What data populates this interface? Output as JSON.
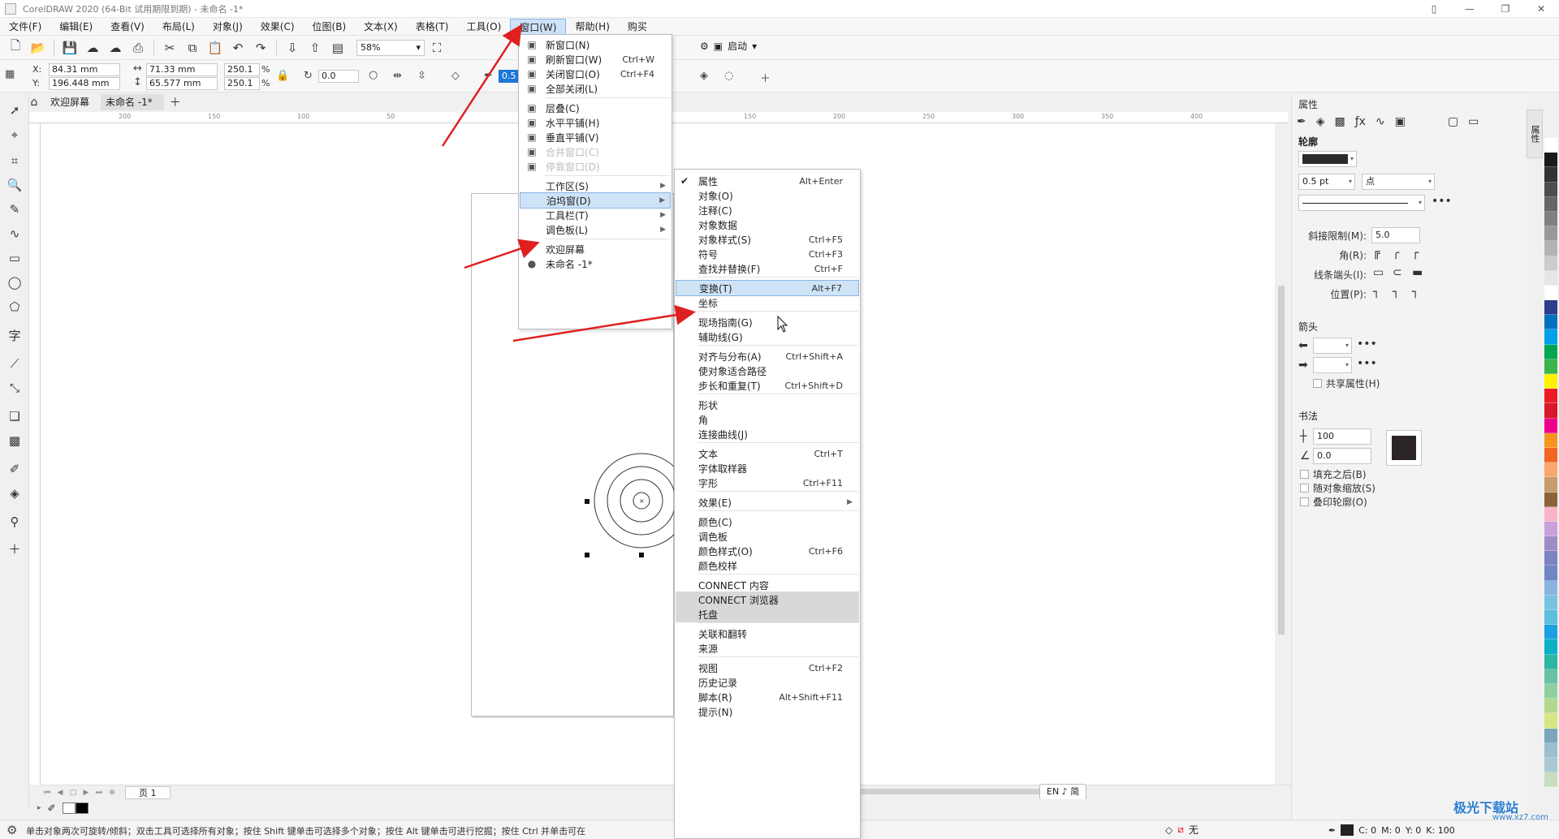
{
  "window": {
    "title": "CorelDRAW 2020 (64-Bit 试用期限到期) - 未命名 -1*"
  },
  "menubar": {
    "items": [
      "文件(F)",
      "编辑(E)",
      "查看(V)",
      "布局(L)",
      "对象(J)",
      "效果(C)",
      "位图(B)",
      "文本(X)",
      "表格(T)",
      "工具(O)",
      "窗口(W)",
      "帮助(H)",
      "购买"
    ],
    "active_index": 10
  },
  "toolbar": {
    "zoom": "58%",
    "launch_label": "启动"
  },
  "propbar": {
    "x_label": "X:",
    "x_value": "84.31 mm",
    "y_label": "Y:",
    "y_value": "196.448 mm",
    "w_value": "71.33 mm",
    "h_value": "65.577 mm",
    "scale_x": "250.1",
    "scale_y": "250.1",
    "percent": "%",
    "rotation": "0.0",
    "outline_width": "0.5 pt"
  },
  "doctabs": {
    "tabs": [
      "欢迎屏幕",
      "未命名 -1*"
    ],
    "active_index": 1
  },
  "ruler": {
    "ticks": [
      "200",
      "150",
      "100",
      "50",
      "",
      "",
      "",
      "150",
      "200",
      "250",
      "300",
      "350",
      "400"
    ]
  },
  "window_menu": {
    "items": [
      {
        "label": "新窗口(N)",
        "shortcut": "",
        "icon": "new-window-icon"
      },
      {
        "label": "刷新窗口(W)",
        "shortcut": "Ctrl+W",
        "icon": "refresh-window-icon"
      },
      {
        "label": "关闭窗口(O)",
        "shortcut": "Ctrl+F4",
        "icon": "close-window-icon"
      },
      {
        "label": "全部关闭(L)",
        "shortcut": "",
        "icon": "close-all-icon"
      },
      {
        "label": "层叠(C)",
        "shortcut": "",
        "icon": "cascade-icon"
      },
      {
        "label": "水平平铺(H)",
        "shortcut": "",
        "icon": "tile-horizontal-icon"
      },
      {
        "label": "垂直平铺(V)",
        "shortcut": "",
        "icon": "tile-vertical-icon"
      },
      {
        "label": "合并窗口(C)",
        "shortcut": "",
        "icon": "merge-window-icon",
        "disabled": true
      },
      {
        "label": "停靠窗口(D)",
        "shortcut": "",
        "icon": "dock-window-icon",
        "disabled": true
      },
      {
        "label": "工作区(S)",
        "shortcut": "",
        "submenu": true
      },
      {
        "label": "泊坞窗(D)",
        "shortcut": "",
        "submenu": true,
        "highlight": true
      },
      {
        "label": "工具栏(T)",
        "shortcut": "",
        "submenu": true
      },
      {
        "label": "调色板(L)",
        "shortcut": "",
        "submenu": true
      },
      {
        "label": "欢迎屏幕",
        "shortcut": ""
      },
      {
        "label": "未命名 -1*",
        "shortcut": "",
        "bullet": true
      }
    ]
  },
  "docker_menu": {
    "items": [
      {
        "label": "属性",
        "shortcut": "Alt+Enter",
        "checked": true
      },
      {
        "label": "对象(O)",
        "shortcut": ""
      },
      {
        "label": "注释(C)",
        "shortcut": ""
      },
      {
        "label": "对象数据",
        "shortcut": ""
      },
      {
        "label": "对象样式(S)",
        "shortcut": "Ctrl+F5"
      },
      {
        "label": "符号",
        "shortcut": "Ctrl+F3"
      },
      {
        "label": "查找并替换(F)",
        "shortcut": "Ctrl+F"
      },
      {
        "label": "变换(T)",
        "shortcut": "Alt+F7",
        "highlight": true
      },
      {
        "label": "坐标",
        "shortcut": ""
      },
      {
        "label": "现场指南(G)",
        "shortcut": ""
      },
      {
        "label": "辅助线(G)",
        "shortcut": ""
      },
      {
        "label": "对齐与分布(A)",
        "shortcut": "Ctrl+Shift+A"
      },
      {
        "label": "使对象适合路径",
        "shortcut": ""
      },
      {
        "label": "步长和重复(T)",
        "shortcut": "Ctrl+Shift+D"
      },
      {
        "label": "形状",
        "shortcut": ""
      },
      {
        "label": "角",
        "shortcut": ""
      },
      {
        "label": "连接曲线(J)",
        "shortcut": ""
      },
      {
        "label": "文本",
        "shortcut": "Ctrl+T"
      },
      {
        "label": "字体取样器",
        "shortcut": ""
      },
      {
        "label": "字形",
        "shortcut": "Ctrl+F11"
      },
      {
        "label": "效果(E)",
        "shortcut": "",
        "submenu": true
      },
      {
        "label": "颜色(C)",
        "shortcut": ""
      },
      {
        "label": "调色板",
        "shortcut": ""
      },
      {
        "label": "颜色样式(O)",
        "shortcut": "Ctrl+F6"
      },
      {
        "label": "颜色校样",
        "shortcut": ""
      },
      {
        "label": "CONNECT 内容",
        "shortcut": ""
      },
      {
        "label": "CONNECT 浏览器",
        "shortcut": "",
        "grey": true
      },
      {
        "label": "托盘",
        "shortcut": "",
        "grey": true
      },
      {
        "label": "关联和翻转",
        "shortcut": ""
      },
      {
        "label": "来源",
        "shortcut": ""
      },
      {
        "label": "视图",
        "shortcut": "Ctrl+F2"
      },
      {
        "label": "历史记录",
        "shortcut": ""
      },
      {
        "label": "脚本(R)",
        "shortcut": "Alt+Shift+F11"
      },
      {
        "label": "提示(N)",
        "shortcut": ""
      }
    ]
  },
  "docker": {
    "title": "属性",
    "outline_heading": "轮廓",
    "outline_width": "0.5 pt",
    "outline_unit": "点",
    "miter_label": "斜接限制(M):",
    "miter_value": "5.0",
    "corner_label": "角(R):",
    "linecap_label": "线条端头(I):",
    "position_label": "位置(P):",
    "arrow_heading": "箭头",
    "share_attr": "共享属性(H)",
    "calligraphy_heading": "书法",
    "stretch_value": "100",
    "angle_value": "0.0",
    "fill_behind": "填充之后(B)",
    "scale_with": "随对象缩放(S)",
    "overprint": "叠印轮廓(O)",
    "side_tab": "属性"
  },
  "canvas": {
    "page_tab": "页 1",
    "ime": "EN ♪ 简"
  },
  "statusbar": {
    "text": "单击对象两次可旋转/倾斜；双击工具可选择所有对象；按住 Shift 键单击可选择多个对象；按住 Alt 键单击可进行挖掘；按住 Ctrl 并单击可在",
    "fill_none": "无",
    "cmyk": [
      "C: 0",
      "M: 0",
      "Y: 0",
      "K: 100"
    ]
  },
  "watermark": {
    "text": "极光下载站",
    "url": "www.xz7.com"
  },
  "palette_colors": [
    "#ffffff",
    "#1a1a1a",
    "#333333",
    "#4d4d4d",
    "#666666",
    "#808080",
    "#999999",
    "#b3b3b3",
    "#cccccc",
    "#e6e6e6",
    "#ffffff",
    "#2b3d8f",
    "#0070c0",
    "#00a0e9",
    "#00a651",
    "#39b54a",
    "#fff200",
    "#ed1c24",
    "#d7182a",
    "#ec008c",
    "#f7941d",
    "#f26522",
    "#f9a870",
    "#c69c6d",
    "#8c6239",
    "#f7b4c6",
    "#c9a0dc",
    "#9e8cc5",
    "#7b83c2",
    "#6f86c5",
    "#8ab4e0",
    "#78c4e0",
    "#5bc0de",
    "#1ba1e2",
    "#0db0c7",
    "#2cb5a0",
    "#66c2a5",
    "#8fd19e",
    "#b3d98e",
    "#d6e685",
    "#7ba7bc",
    "#9bbfcf",
    "#a9c8d4",
    "#c8dcc0"
  ]
}
